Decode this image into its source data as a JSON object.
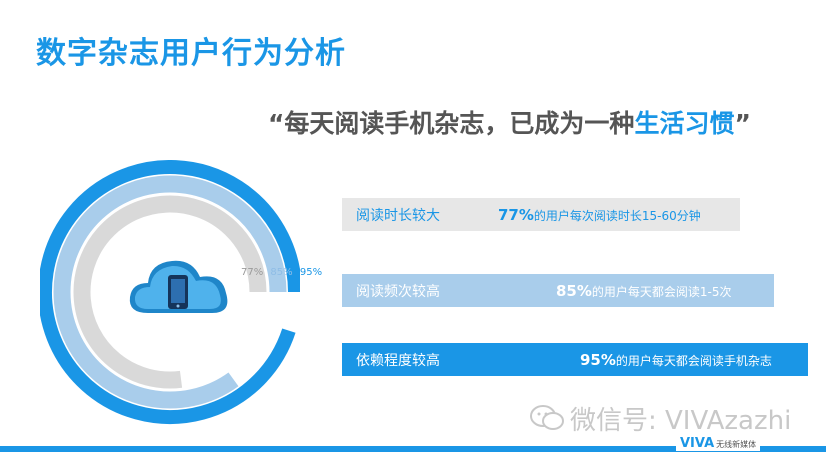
{
  "header": {
    "title": "数字杂志用户行为分析"
  },
  "quote": {
    "prefix": "“每天阅读手机杂志，已成为一种",
    "highlight": "生活习惯",
    "suffix": "”"
  },
  "chart_data": {
    "type": "radial-bar",
    "series": [
      {
        "name": "阅读时长较大",
        "value": 77,
        "label": "77%",
        "description": "的用户每次阅读时长15-60分钟",
        "color": "#d9d9d9"
      },
      {
        "name": "阅读频次较高",
        "value": 85,
        "label": "85%",
        "description": "的用户每天都会阅读1-5次",
        "color": "#a9cdeb"
      },
      {
        "name": "依赖程度较高",
        "value": 95,
        "label": "95%",
        "description": "的用户每天都会阅读手机杂志",
        "color": "#1a96e6"
      }
    ]
  },
  "icons": {
    "center": "cloud-phone-icon",
    "wechat": "wechat-icon"
  },
  "watermark": {
    "text": "微信号: VIVAzazhi"
  },
  "brand": {
    "name": "VIVA",
    "subtitle": "无线新媒体"
  },
  "colors": {
    "accent": "#1a96e6",
    "light": "#a9cdeb",
    "gray": "#d9d9d9",
    "text": "#555555"
  }
}
